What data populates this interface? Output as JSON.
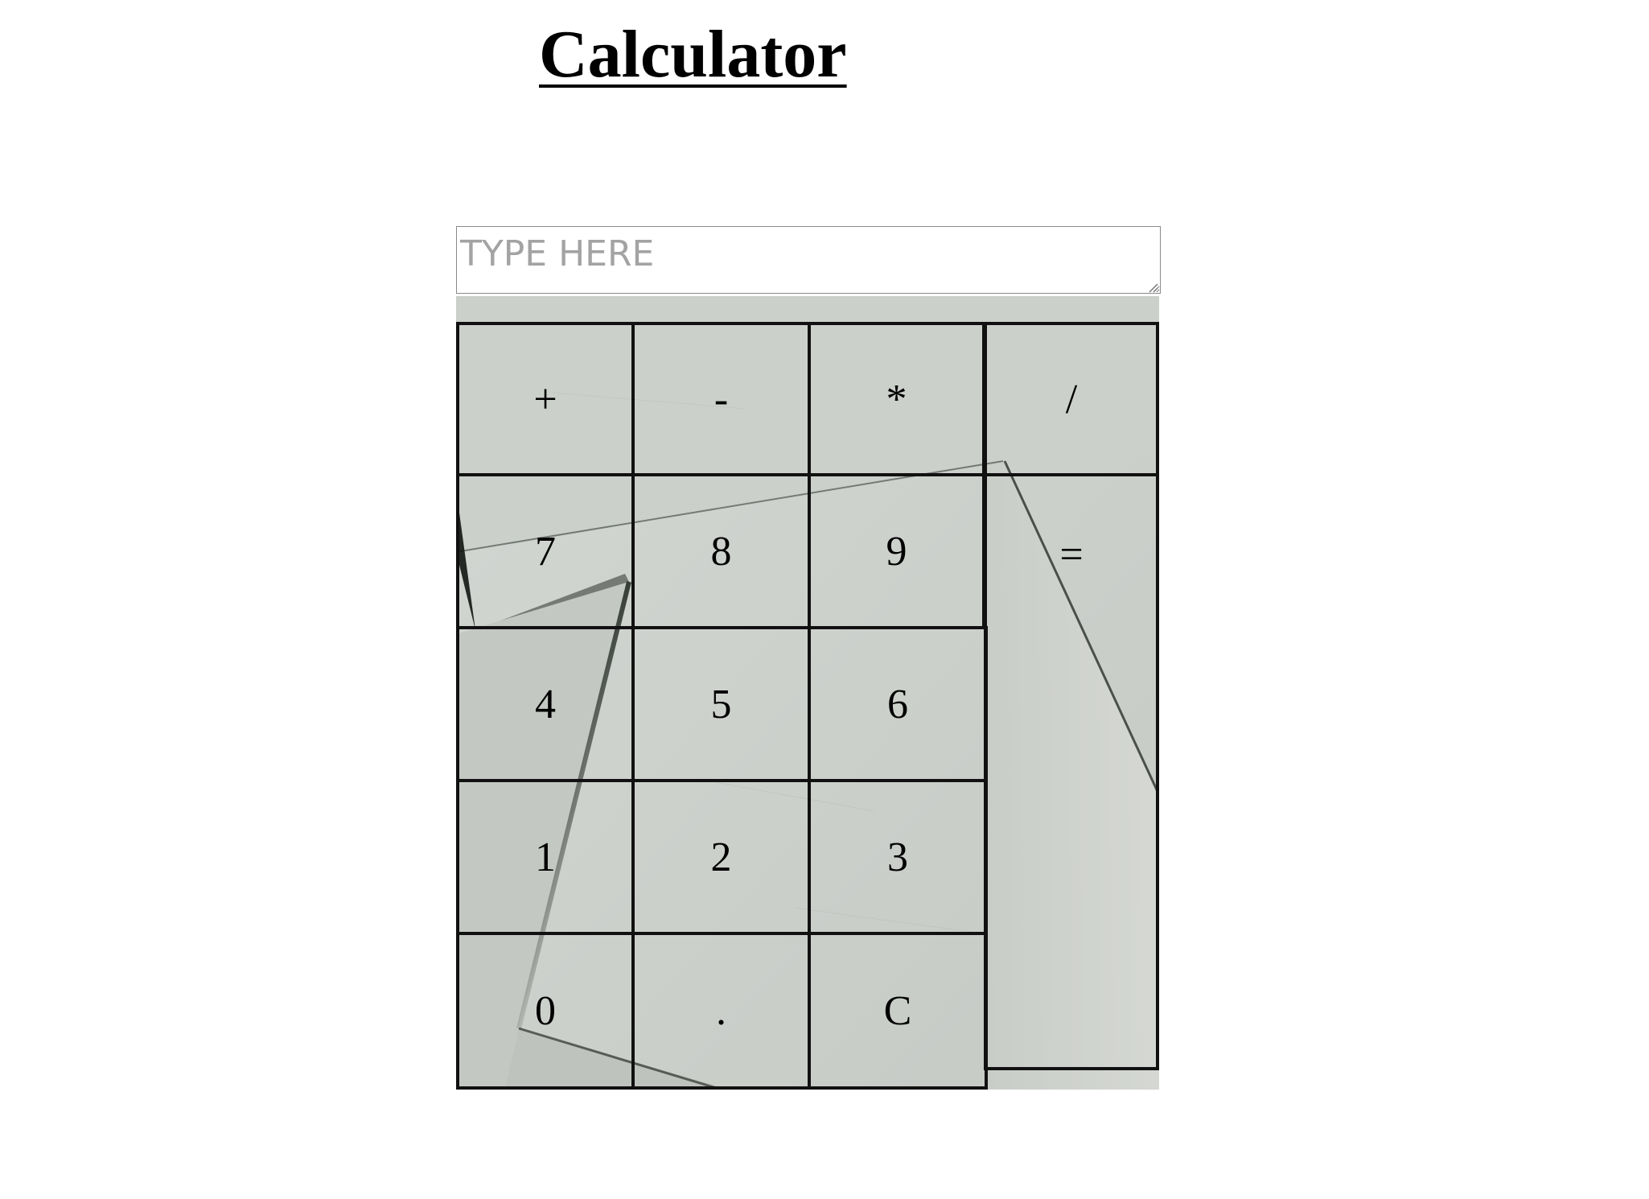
{
  "header": {
    "title": "Calculator"
  },
  "display": {
    "placeholder": "TYPE HERE",
    "value": ""
  },
  "keys": {
    "plus": "+",
    "minus": "-",
    "multiply": "*",
    "divide": "/",
    "seven": "7",
    "eight": "8",
    "nine": "9",
    "equals": "=",
    "four": "4",
    "five": "5",
    "six": "6",
    "one": "1",
    "two": "2",
    "three": "3",
    "zero": "0",
    "dot": ".",
    "clear": "C"
  },
  "colors": {
    "key_border": "#111111",
    "keypad_background": "#cfd3ce",
    "paper_shadow": "#1e241f",
    "placeholder": "#a3a3a3"
  }
}
